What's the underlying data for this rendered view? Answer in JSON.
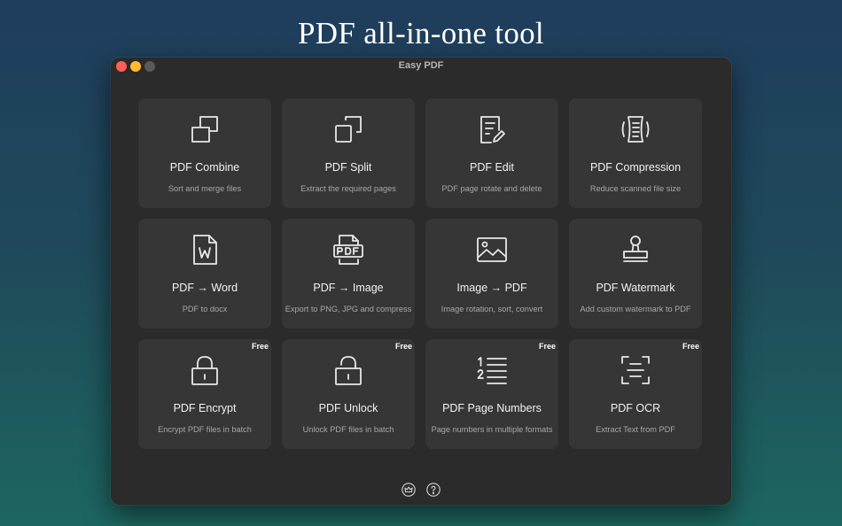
{
  "headline": "PDF all-in-one tool",
  "window": {
    "title": "Easy PDF"
  },
  "tools": [
    {
      "title": "PDF Combine",
      "subtitle": "Sort and merge files",
      "badge": "",
      "icon": "combine-icon"
    },
    {
      "title": "PDF Split",
      "subtitle": "Extract the required pages",
      "badge": "",
      "icon": "split-icon"
    },
    {
      "title": "PDF Edit",
      "subtitle": "PDF page rotate and delete",
      "badge": "",
      "icon": "edit-icon"
    },
    {
      "title": "PDF Compression",
      "subtitle": "Reduce scanned file size",
      "badge": "",
      "icon": "compression-icon"
    },
    {
      "title": "PDF → Word",
      "subtitle": "PDF to docx",
      "badge": "",
      "icon": "word-file-icon"
    },
    {
      "title": "PDF → Image",
      "subtitle": "Export to PNG, JPG and compress",
      "badge": "",
      "icon": "pdf-image-icon"
    },
    {
      "title": "Image → PDF",
      "subtitle": "Image rotation, sort, convert",
      "badge": "",
      "icon": "image-icon"
    },
    {
      "title": "PDF Watermark",
      "subtitle": "Add custom watermark to PDF",
      "badge": "",
      "icon": "stamp-icon"
    },
    {
      "title": "PDF Encrypt",
      "subtitle": "Encrypt PDF files in batch",
      "badge": "Free",
      "icon": "lock-icon"
    },
    {
      "title": "PDF Unlock",
      "subtitle": "Unlock PDF files in batch",
      "badge": "Free",
      "icon": "unlock-icon"
    },
    {
      "title": "PDF Page Numbers",
      "subtitle": "Page numbers in multiple formats",
      "badge": "Free",
      "icon": "numbered-list-icon"
    },
    {
      "title": "PDF OCR",
      "subtitle": "Extract Text from PDF",
      "badge": "Free",
      "icon": "ocr-scan-icon"
    }
  ],
  "footer": {
    "icons": [
      "crown-icon",
      "help-icon"
    ]
  }
}
